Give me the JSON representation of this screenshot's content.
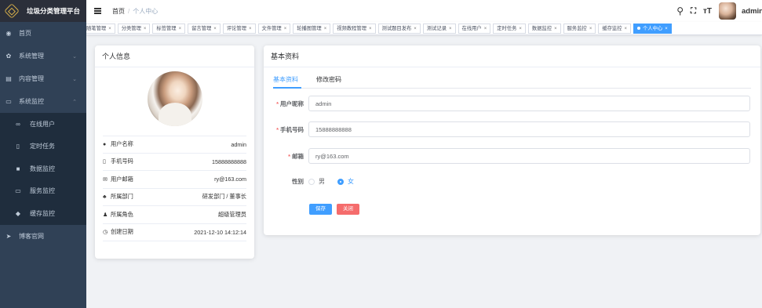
{
  "app": {
    "title": "垃圾分类管理平台"
  },
  "sidebar": {
    "items": [
      {
        "label": "首页",
        "icon": "dashboard-icon"
      },
      {
        "label": "系统管理",
        "icon": "gear-icon",
        "expandable": true
      },
      {
        "label": "内容管理",
        "icon": "document-icon",
        "expandable": true
      },
      {
        "label": "系统监控",
        "icon": "monitor-icon",
        "expandable": true,
        "expanded": true
      }
    ],
    "submenu": [
      {
        "label": "在线用户",
        "icon": "online-icon"
      },
      {
        "label": "定时任务",
        "icon": "job-icon"
      },
      {
        "label": "数据监控",
        "icon": "druid-icon"
      },
      {
        "label": "服务监控",
        "icon": "server-icon"
      },
      {
        "label": "缓存监控",
        "icon": "redis-icon"
      }
    ],
    "extra": {
      "label": "博客官网",
      "icon": "send-icon"
    }
  },
  "header": {
    "breadcrumb": {
      "home": "首页",
      "separator": "/",
      "current": "个人中心"
    },
    "username": "admin",
    "icons": [
      "search-icon",
      "fullscreen-icon",
      "font-size-icon"
    ]
  },
  "tags": [
    {
      "label": "随笔管理"
    },
    {
      "label": "分类管理"
    },
    {
      "label": "标签管理"
    },
    {
      "label": "留言管理"
    },
    {
      "label": "评论管理"
    },
    {
      "label": "文件管理"
    },
    {
      "label": "轮播图管理"
    },
    {
      "label": "视频教程管理"
    },
    {
      "label": "测试题目发布"
    },
    {
      "label": "测试记录"
    },
    {
      "label": "在线用户"
    },
    {
      "label": "定时任务"
    },
    {
      "label": "数据监控"
    },
    {
      "label": "服务监控"
    },
    {
      "label": "缓存监控"
    },
    {
      "label": "个人中心",
      "active": true
    }
  ],
  "profile": {
    "title": "个人信息",
    "rows": [
      {
        "label": "用户名称",
        "value": "admin",
        "icon": "user-icon"
      },
      {
        "label": "手机号码",
        "value": "15888888888",
        "icon": "phone-icon"
      },
      {
        "label": "用户邮箱",
        "value": "ry@163.com",
        "icon": "email-icon"
      },
      {
        "label": "所属部门",
        "value": "研发部门 / 董事长",
        "icon": "tree-icon"
      },
      {
        "label": "所属角色",
        "value": "超级管理员",
        "icon": "peoples-icon"
      },
      {
        "label": "创建日期",
        "value": "2021-12-10 14:12:14",
        "icon": "date-icon"
      }
    ]
  },
  "basic": {
    "title": "基本资料",
    "tabs": [
      "基本资料",
      "修改密码"
    ],
    "fields": {
      "nickname": {
        "label": "用户昵称",
        "value": "admin"
      },
      "phone": {
        "label": "手机号码",
        "value": "15888888888"
      },
      "email": {
        "label": "邮箱",
        "value": "ry@163.com"
      },
      "sex": {
        "label": "性别",
        "options": [
          "男",
          "女"
        ],
        "selected": "女"
      }
    },
    "buttons": {
      "save": "保存",
      "close": "关闭"
    }
  }
}
